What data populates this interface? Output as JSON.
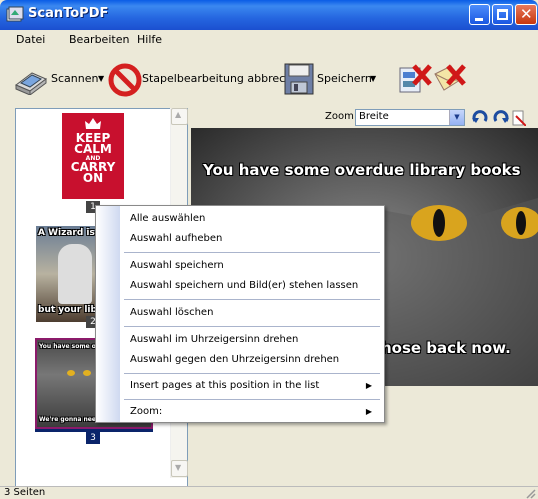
{
  "window": {
    "title": "ScanToPDF"
  },
  "menubar": {
    "items": [
      {
        "label": "Datei",
        "accel": "D"
      },
      {
        "label": "Bearbeiten",
        "accel": "B"
      },
      {
        "label": "Hilfe",
        "accel": "H"
      }
    ]
  },
  "toolbar": {
    "scan_label": "Scannen",
    "cancel_batch_label": "Stapelbearbeitung abbrechen",
    "save_label": "Speichern"
  },
  "zoom": {
    "label": "Zoom:",
    "value": "Breite"
  },
  "thumbnails": [
    {
      "number": "1",
      "lines": [
        "KEEP",
        "CALM",
        "AND",
        "CARRY",
        "ON"
      ]
    },
    {
      "number": "2",
      "top_text": "A Wizard is N",
      "bottom_text": "but your libr"
    },
    {
      "number": "3",
      "top_text": "You have some overdue",
      "bottom_text": "We're gonna need"
    }
  ],
  "page_view": {
    "top_text": "You have some overdue library books",
    "bottom_text": "hose back now."
  },
  "context_menu": {
    "items": [
      {
        "label": "Alle auswählen"
      },
      {
        "label": "Auswahl aufheben"
      },
      {
        "label": "Auswahl speichern"
      },
      {
        "label": "Auswahl speichern und Bild(er) stehen lassen"
      },
      {
        "label": "Auswahl löschen"
      },
      {
        "label": "Auswahl im Uhrzeigersinn drehen"
      },
      {
        "label": "Auswahl gegen den Uhrzeigersinn drehen"
      },
      {
        "label": "Insert pages at this position in the list",
        "submenu": true
      },
      {
        "label": "Zoom:",
        "submenu": true
      }
    ]
  },
  "statusbar": {
    "text": "3 Seiten"
  },
  "colors": {
    "titlebar": "#2566e0",
    "selection": "#0a246a",
    "keep_calm_red": "#c8102e"
  }
}
